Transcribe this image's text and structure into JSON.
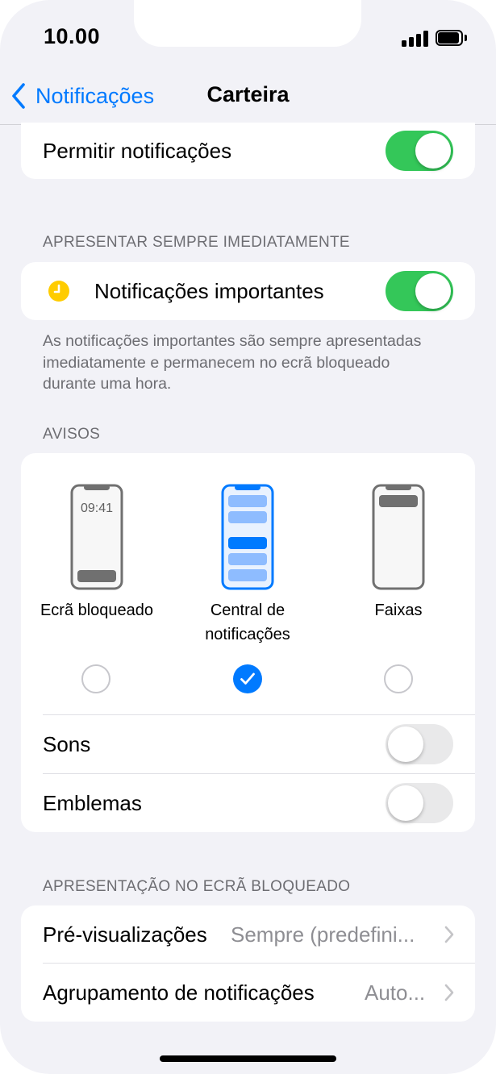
{
  "status_bar": {
    "time": "10.00",
    "icons": [
      "signal-icon",
      "battery-icon"
    ]
  },
  "nav": {
    "back_label": "Notificações",
    "title": "Carteira",
    "back_icon": "chevron-left-icon"
  },
  "allow": {
    "label": "Permitir notificações",
    "enabled": true
  },
  "important": {
    "header": "APRESENTAR SEMPRE IMEDIATAMENTE",
    "label": "Notificações importantes",
    "icon": "clock-icon",
    "enabled": true,
    "footer": "As notificações importantes são sempre apresentadas imediatamente e permanecem no ecrã bloqueado durante uma hora."
  },
  "alerts": {
    "header": "AVISOS",
    "lock_screen_time": "09:41",
    "options": [
      {
        "label": "Ecrã bloqueado",
        "selected": false
      },
      {
        "label_line1": "Central de",
        "label_line2": "notificações",
        "selected": true
      },
      {
        "label": "Faixas",
        "selected": false
      }
    ],
    "sounds": {
      "label": "Sons",
      "enabled": false
    },
    "badges": {
      "label": "Emblemas",
      "enabled": false
    }
  },
  "lock_screen": {
    "header": "APRESENTAÇÃO NO ECRÃ BLOQUEADO",
    "previews": {
      "label": "Pré-visualizações",
      "value": "Sempre (predefini..."
    },
    "grouping": {
      "label": "Agrupamento de notificações",
      "value": "Auto..."
    }
  },
  "colors": {
    "accent": "#007aff",
    "toggle_on": "#34c759",
    "background": "#f2f2f7",
    "secondary_text": "#6d6d72"
  }
}
